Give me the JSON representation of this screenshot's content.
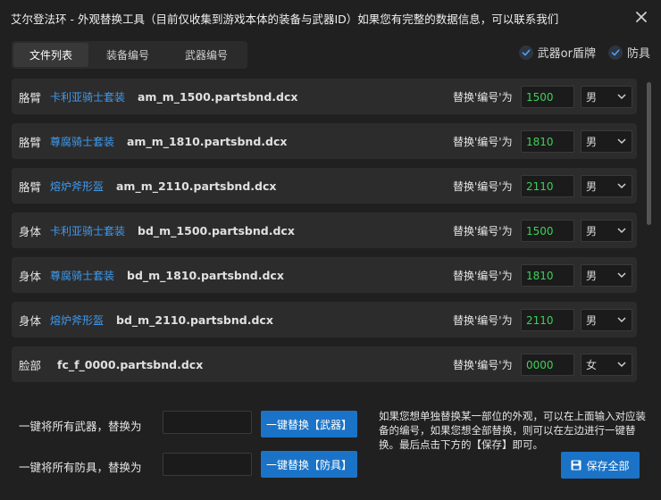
{
  "window": {
    "title": "艾尔登法环 - 外观替换工具（目前仅收集到游戏本体的装备与武器ID）如果您有完整的数据信息，可以联系我们"
  },
  "tabs": [
    {
      "label": "文件列表",
      "active": true
    },
    {
      "label": "装备编号",
      "active": false
    },
    {
      "label": "武器编号",
      "active": false
    }
  ],
  "filters": {
    "weapon_shield": {
      "label": "武器or盾牌",
      "checked": true
    },
    "armor": {
      "label": "防具",
      "checked": true
    }
  },
  "rows": [
    {
      "category": "胳臂",
      "set_name": "卡利亚骑士套装",
      "file": "am_m_1500.partsbnd.dcx",
      "replace_label": "替换'编号'为",
      "value": "1500",
      "gender": "男"
    },
    {
      "category": "胳臂",
      "set_name": "尊腐骑士套装",
      "file": "am_m_1810.partsbnd.dcx",
      "replace_label": "替换'编号'为",
      "value": "1810",
      "gender": "男"
    },
    {
      "category": "胳臂",
      "set_name": "熔炉斧形盔",
      "file": "am_m_2110.partsbnd.dcx",
      "replace_label": "替换'编号'为",
      "value": "2110",
      "gender": "男"
    },
    {
      "category": "身体",
      "set_name": "卡利亚骑士套装",
      "file": "bd_m_1500.partsbnd.dcx",
      "replace_label": "替换'编号'为",
      "value": "1500",
      "gender": "男"
    },
    {
      "category": "身体",
      "set_name": "尊腐骑士套装",
      "file": "bd_m_1810.partsbnd.dcx",
      "replace_label": "替换'编号'为",
      "value": "1810",
      "gender": "男"
    },
    {
      "category": "身体",
      "set_name": "熔炉斧形盔",
      "file": "bd_m_2110.partsbnd.dcx",
      "replace_label": "替换'编号'为",
      "value": "2110",
      "gender": "男"
    },
    {
      "category": "脸部",
      "set_name": "",
      "file": "fc_f_0000.partsbnd.dcx",
      "replace_label": "替换'编号'为",
      "value": "0000",
      "gender": "女"
    }
  ],
  "bulk": {
    "weapons_label": "一键将所有武器，替换为",
    "weapons_value": "",
    "weapons_button": "一键替换【武器】",
    "armor_label": "一键将所有防具，替换为",
    "armor_value": "",
    "armor_button": "一键替换【防具】",
    "note": "如果您想单独替换某一部位的外观，可以在上面输入对应装备的编号，如果您想全部替换，则可以在左边进行一键替换。最后点击下方的【保存】即可。",
    "save_button": "保存全部"
  },
  "colors": {
    "accent": "#1a73c7",
    "link": "#3f9bf0",
    "value_text": "#3fcf5a",
    "background": "#202020",
    "row_background": "#2c2c2c"
  }
}
